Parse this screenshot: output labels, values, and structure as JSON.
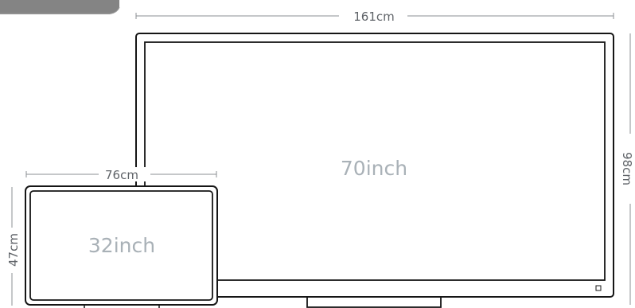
{
  "large_tv": {
    "width_label": "161cm",
    "height_label": "98cm",
    "size_label": "70inch"
  },
  "small_tv": {
    "width_label": "76cm",
    "height_label": "47cm",
    "size_label": "32inch"
  },
  "colors": {
    "frame": "#151515",
    "dimension_text": "#5f6368",
    "size_text": "#a9b1b7",
    "fabric": "#848484"
  }
}
